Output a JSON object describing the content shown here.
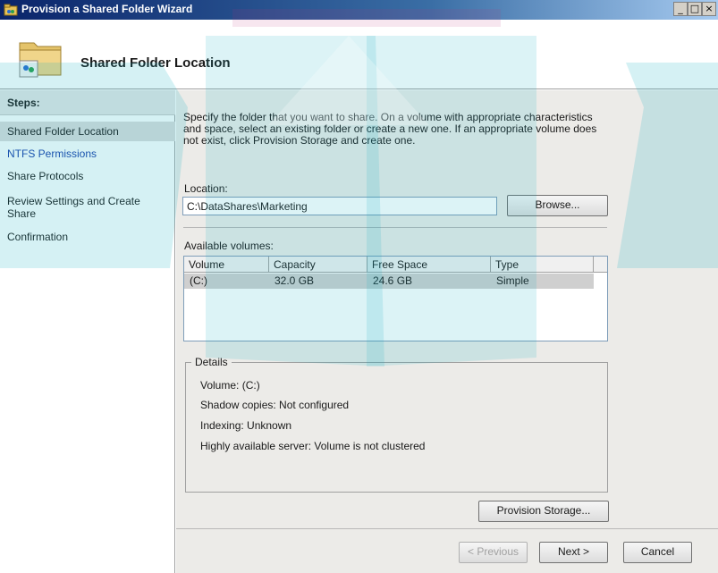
{
  "window": {
    "title": "Provision a Shared Folder Wizard",
    "controls": {
      "minimize": "_",
      "maximize": "□",
      "close": "×"
    }
  },
  "header": {
    "title": "Shared Folder Location"
  },
  "steps": {
    "heading": "Steps:",
    "items": [
      {
        "label": "Shared Folder Location"
      },
      {
        "label": "NTFS Permissions"
      },
      {
        "label": "Share Protocols"
      },
      {
        "label": "Review Settings and Create Share"
      },
      {
        "label": "Confirmation"
      }
    ]
  },
  "main": {
    "description": "Specify the folder that you want to share. On a volume with appropriate characteristics and space, select an existing folder or create a new one. If an appropriate volume does not exist, click Provision Storage and create one.",
    "location_label": "Location:",
    "location_value": "C:\\DataShares\\Marketing",
    "browse_label": "Browse...",
    "available_volumes_label": "Available volumes:",
    "volumes_columns": [
      "Volume",
      "Capacity",
      "Free Space",
      "Type"
    ],
    "volumes_rows": [
      {
        "volume": "(C:)",
        "capacity": "32.0 GB",
        "free_space": "24.6 GB",
        "type": "Simple"
      }
    ],
    "details": {
      "legend": "Details",
      "volume": "Volume:  (C:)",
      "shadow_copies": "Shadow copies:  Not configured",
      "indexing": "Indexing:  Unknown",
      "ha_server": "Highly available server:  Volume is not clustered"
    },
    "provision_storage_label": "Provision Storage..."
  },
  "footer": {
    "previous_label": "< Previous",
    "next_label": "Next >",
    "cancel_label": "Cancel"
  }
}
